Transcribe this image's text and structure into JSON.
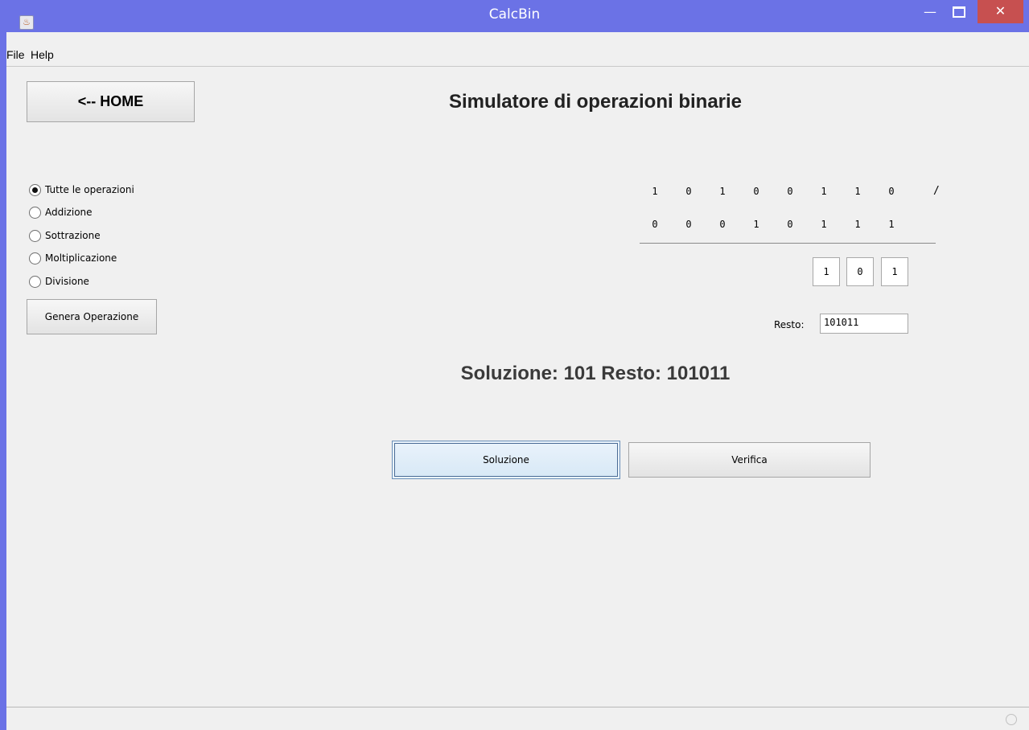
{
  "window": {
    "title": "CalcBin",
    "minimize": "—",
    "close": "✕"
  },
  "menu": {
    "file": "File",
    "help": "Help"
  },
  "home_button": "<-- HOME",
  "page_title": "Simulatore di operazioni binarie",
  "operations": [
    {
      "label": "Tutte le operazioni",
      "selected": true
    },
    {
      "label": "Addizione",
      "selected": false
    },
    {
      "label": "Sottrazione",
      "selected": false
    },
    {
      "label": "Moltiplicazione",
      "selected": false
    },
    {
      "label": "Divisione",
      "selected": false
    }
  ],
  "generate_button": "Genera Operazione",
  "operand1": [
    "1",
    "0",
    "1",
    "0",
    "0",
    "1",
    "1",
    "0"
  ],
  "operand2": [
    "0",
    "0",
    "0",
    "1",
    "0",
    "1",
    "1",
    "1"
  ],
  "operator": "/",
  "answer_digits": [
    "1",
    "0",
    "1"
  ],
  "remainder_label": "Resto:",
  "remainder_value": "101011",
  "solution_text": "Soluzione: 101 Resto: 101011",
  "buttons": {
    "solution": "Soluzione",
    "verify": "Verifica"
  }
}
